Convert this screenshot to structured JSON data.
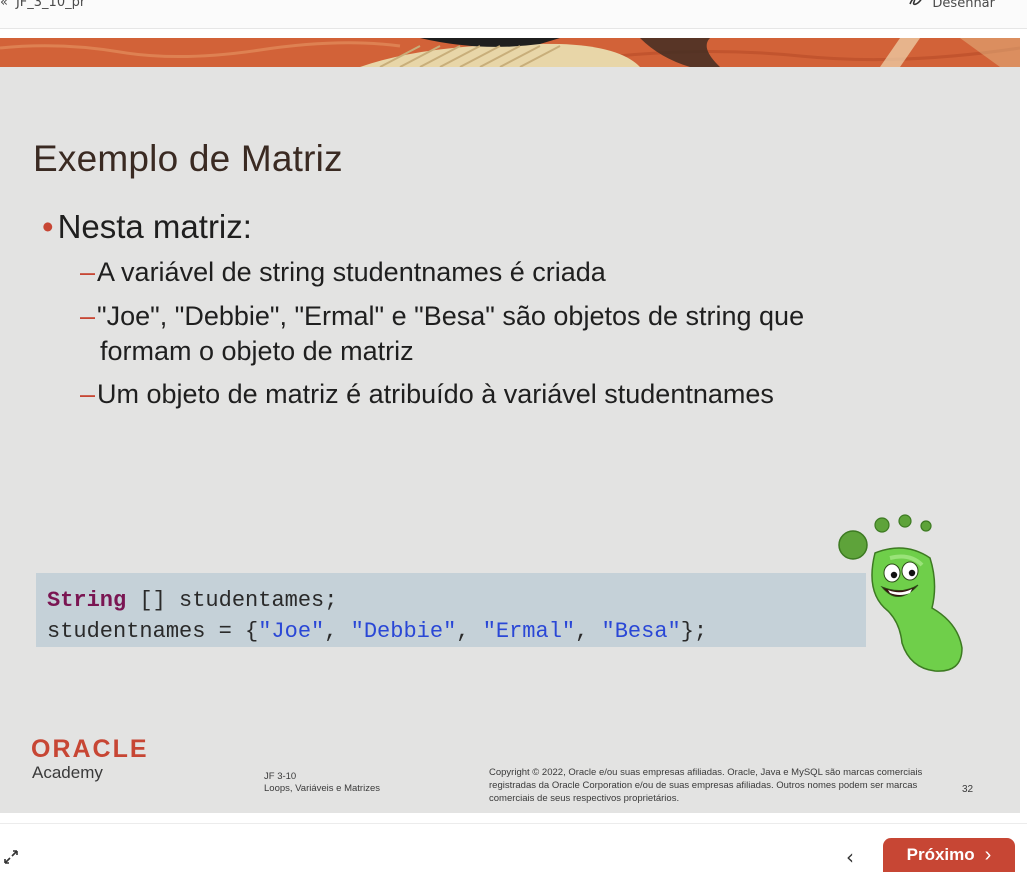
{
  "topbar": {
    "back_label": "JF_3_10_pr",
    "draw_label": "Desenhar"
  },
  "slide": {
    "title": "Exemplo de Matriz",
    "bullet": "Nesta matriz:",
    "subpoints": [
      "A variável de string studentnames é criada",
      "\"Joe\", \"Debbie\", \"Ermal\" e \"Besa\" são objetos de string que",
      "formam o objeto de matriz",
      "Um objeto de matriz é atribuído à variável studentnames"
    ],
    "code": {
      "line1_keyword": "String",
      "line1_rest": " [] studentames;",
      "line2_prefix": "studentnames = {",
      "strings": [
        "\"Joe\"",
        "\"Debbie\"",
        "\"Ermal\"",
        "\"Besa\""
      ],
      "line2_suffix": "};"
    },
    "footer": {
      "brand": "ORACLE",
      "academy": "Academy",
      "course_code": "JF 3-10",
      "course_title": "Loops, Variáveis e Matrizes",
      "copyright": "Copyright © 2022, Oracle e/ou suas empresas afiliadas. Oracle, Java e MySQL são marcas comerciais registradas da Oracle Corporation e/ou de suas empresas afiliadas. Outros nomes podem ser marcas comerciais de seus respectivos proprietários.",
      "page_number": "32"
    }
  },
  "nav": {
    "next_label": "Próximo"
  },
  "colors": {
    "accent": "#c74634",
    "slide_bg": "#e3e3e2",
    "code_bg": "#c5d1d8"
  },
  "icons": [
    "double-chevron-left-icon",
    "draw-icon",
    "expand-icon",
    "chevron-left-icon",
    "chevron-right-icon"
  ]
}
